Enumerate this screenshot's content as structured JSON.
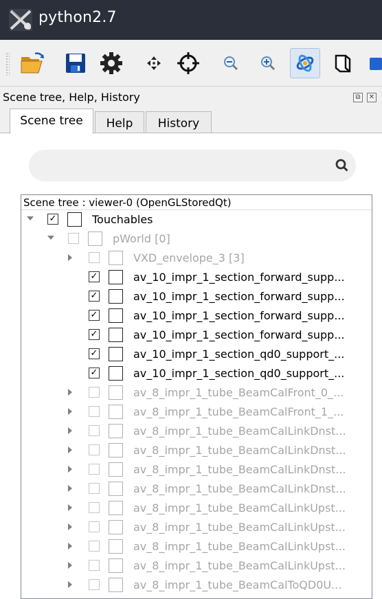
{
  "window": {
    "title": "python2.7"
  },
  "toolbar": {
    "icons": [
      "folder-open-icon",
      "save-icon",
      "settings-icon",
      "move-icon",
      "target-icon",
      "zoom-out-icon",
      "zoom-in-icon",
      "rotate-icon",
      "perspective-icon",
      "color-icon"
    ],
    "active": "rotate-icon"
  },
  "dock": {
    "title": "Scene tree, Help, History",
    "float_label": "⧉",
    "close_label": "✕"
  },
  "tabs": [
    {
      "label": "Scene tree",
      "selected": true
    },
    {
      "label": "Help",
      "selected": false
    },
    {
      "label": "History",
      "selected": false
    }
  ],
  "search": {
    "placeholder": ""
  },
  "tree": {
    "header": "Scene tree : viewer-0 (OpenGLStoredQt)",
    "rows": [
      {
        "label": "Touchables",
        "checked": true,
        "enabled": true,
        "expander": "down",
        "level": 0
      },
      {
        "label": "pWorld [0]",
        "checked": false,
        "enabled": false,
        "expander": "down",
        "level": 1
      },
      {
        "label": "VXD_envelope_3 [3]",
        "checked": false,
        "enabled": false,
        "expander": "right",
        "level": 2
      },
      {
        "label": "av_10_impr_1_section_forward_supp...",
        "checked": true,
        "enabled": true,
        "expander": "none",
        "level": 2
      },
      {
        "label": "av_10_impr_1_section_forward_supp...",
        "checked": true,
        "enabled": true,
        "expander": "none",
        "level": 2
      },
      {
        "label": "av_10_impr_1_section_forward_supp...",
        "checked": true,
        "enabled": true,
        "expander": "none",
        "level": 2
      },
      {
        "label": "av_10_impr_1_section_forward_supp...",
        "checked": true,
        "enabled": true,
        "expander": "none",
        "level": 2
      },
      {
        "label": "av_10_impr_1_section_qd0_support_...",
        "checked": true,
        "enabled": true,
        "expander": "none",
        "level": 2
      },
      {
        "label": "av_10_impr_1_section_qd0_support_...",
        "checked": true,
        "enabled": true,
        "expander": "none",
        "level": 2
      },
      {
        "label": "av_8_impr_1_tube_BeamCalFront_0_...",
        "checked": false,
        "enabled": false,
        "expander": "right",
        "level": 2
      },
      {
        "label": "av_8_impr_1_tube_BeamCalFront_1_...",
        "checked": false,
        "enabled": false,
        "expander": "right",
        "level": 2
      },
      {
        "label": "av_8_impr_1_tube_BeamCalLinkDnst...",
        "checked": false,
        "enabled": false,
        "expander": "right",
        "level": 2
      },
      {
        "label": "av_8_impr_1_tube_BeamCalLinkDnst...",
        "checked": false,
        "enabled": false,
        "expander": "right",
        "level": 2
      },
      {
        "label": "av_8_impr_1_tube_BeamCalLinkDnst...",
        "checked": false,
        "enabled": false,
        "expander": "right",
        "level": 2
      },
      {
        "label": "av_8_impr_1_tube_BeamCalLinkDnst...",
        "checked": false,
        "enabled": false,
        "expander": "right",
        "level": 2
      },
      {
        "label": "av_8_impr_1_tube_BeamCalLinkUpst...",
        "checked": false,
        "enabled": false,
        "expander": "right",
        "level": 2
      },
      {
        "label": "av_8_impr_1_tube_BeamCalLinkUpst...",
        "checked": false,
        "enabled": false,
        "expander": "right",
        "level": 2
      },
      {
        "label": "av_8_impr_1_tube_BeamCalLinkUpst...",
        "checked": false,
        "enabled": false,
        "expander": "right",
        "level": 2
      },
      {
        "label": "av_8_impr_1_tube_BeamCalLinkUpst...",
        "checked": false,
        "enabled": false,
        "expander": "right",
        "level": 2
      },
      {
        "label": "av_8_impr_1_tube_BeamCalToQD0U...",
        "checked": false,
        "enabled": false,
        "expander": "right",
        "level": 2
      }
    ]
  }
}
